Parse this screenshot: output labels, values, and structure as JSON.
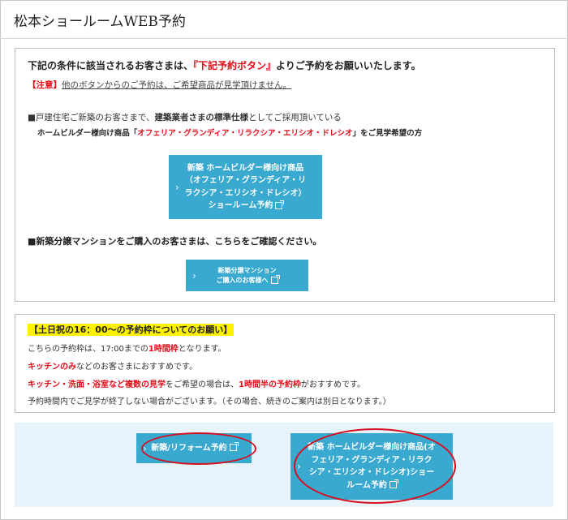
{
  "page": {
    "title": "松本ショールームWEB予約"
  },
  "notice": {
    "intro_prefix": "下記の条件に該当されるお客さまは、",
    "intro_highlight": "『下記予約ボタン』",
    "intro_suffix": "よりご予約をお願いいたします。",
    "warning_tag": "【注意】",
    "warning_text": "他のボタンからのご予約は、ご希望商品が見学頂けません。",
    "cond1_prefix": "■戸建住宅ご新築のお客さまで、",
    "cond1_bold": "建築業者さまの標準仕様",
    "cond1_suffix": "としてご採用頂いている",
    "cond2_prefix": "ホームビルダー様向け商品「",
    "cond2_products": "オフェリア・グランディア・リラクシア・エリシオ・ドレシオ",
    "cond2_suffix": "」をご見学希望の方",
    "builder_button": {
      "line1": "新築 ホームビルダー様向け商品",
      "line2": "（オフェリア・グランディア・リ",
      "line3": "ラクシア・エリシオ・ドレシオ）",
      "line4": "ショールーム予約"
    },
    "condo_text": "■新築分譲マンションをご購入のお客さまは、こちらをご確認ください。",
    "condo_button": {
      "line1": "新築分譲マンション",
      "line2": "ご購入のお客様へ"
    }
  },
  "weekend": {
    "heading": "【土日祝の16：00～の予約枠についてのお願い】",
    "l1_prefix": "こちらの予約枠は、17:00までの",
    "l1_red": "1時間枠",
    "l1_suffix": "となります。",
    "l2_red": "キッチンのみ",
    "l2_suffix": "などのお客さまにおすすめです。",
    "l3_red": "キッチン・洗面・浴室など複数の見学",
    "l3_mid": "をご希望の場合は、",
    "l3_red2": "1時間半の予約枠",
    "l3_suffix": "がおすすめです。",
    "l4": "予約時間内でご見学が終了しない場合がございます。（その場合、続きのご案内は別日となります。）"
  },
  "footer": {
    "reform_button": "新築/リフォーム予約",
    "builder_button": {
      "line1": "新築 ホームビルダー様向け商品(オ",
      "line2": "フェリア・グランディア・リラク",
      "line3": "シア・エリシオ・ドレシオ)ショー",
      "line4": "ルーム予約"
    }
  },
  "colors": {
    "button": "#3aa9cf",
    "accent_red": "#e30b17",
    "highlight": "#fff200",
    "footer_bg": "#e7f3fa",
    "annotation_red": "#d60f1f"
  },
  "icons": {
    "chevron": "chevron-right-icon",
    "external": "external-link-icon"
  }
}
